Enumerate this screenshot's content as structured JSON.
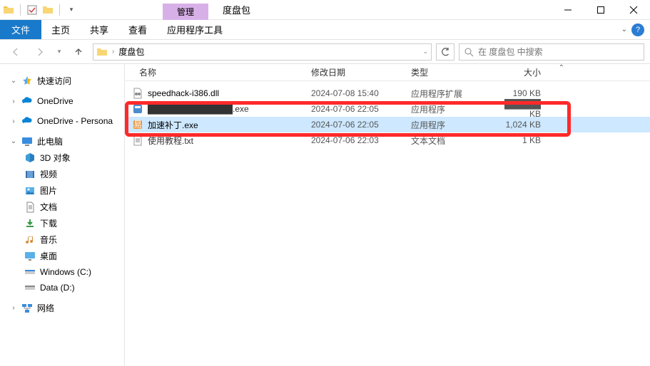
{
  "window": {
    "context_tab": "管理",
    "title": "度盘包"
  },
  "menubar": {
    "file": "文件",
    "items": [
      "主页",
      "共享",
      "查看"
    ],
    "tool_tab": "应用程序工具"
  },
  "nav": {
    "crumb": "度盘包",
    "search_placeholder": "在 度盘包 中搜索"
  },
  "columns": {
    "name": "名称",
    "date": "修改日期",
    "type": "类型",
    "size": "大小"
  },
  "files": [
    {
      "icon": "dll",
      "name": "speedhack-i386.dll",
      "date": "2024-07-08 15:40",
      "type": "应用程序扩展",
      "size": "190 KB"
    },
    {
      "icon": "exe",
      "name": "██████████████.exe",
      "date": "2024-07-06 22:05",
      "type": "应用程序",
      "size": "██████ KB",
      "obscured": true
    },
    {
      "icon": "exe-e",
      "name": "加速补丁.exe",
      "date": "2024-07-06 22:05",
      "type": "应用程序",
      "size": "1,024 KB",
      "selected": true
    },
    {
      "icon": "txt",
      "name": "使用教程.txt",
      "date": "2024-07-06 22:03",
      "type": "文本文档",
      "size": "1 KB",
      "obscured": true
    }
  ],
  "sidebar": {
    "quick": "快速访问",
    "onedrive": "OneDrive",
    "onedrive_personal": "OneDrive - Persona",
    "thispc": "此电脑",
    "pc_items": [
      "3D 对象",
      "视频",
      "图片",
      "文档",
      "下载",
      "音乐",
      "桌面",
      "Windows (C:)",
      "Data (D:)"
    ],
    "network": "网络"
  }
}
